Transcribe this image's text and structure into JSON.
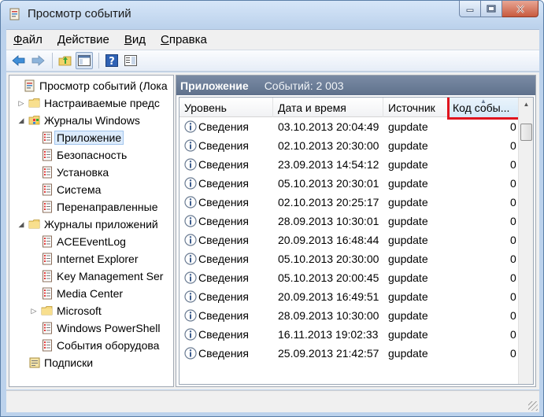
{
  "window": {
    "title": "Просмотр событий",
    "icon": "event-viewer-icon",
    "caption_buttons": [
      "minimize-icon",
      "maximize-icon",
      "close-icon"
    ]
  },
  "menu": {
    "items": [
      {
        "label": "Файл",
        "accel": "Ф",
        "rest": "айл"
      },
      {
        "label": "Действие",
        "accel": "Д",
        "rest": "ействие"
      },
      {
        "label": "Вид",
        "accel": "В",
        "rest": "ид"
      },
      {
        "label": "Справка",
        "accel": "С",
        "rest": "правка"
      }
    ]
  },
  "toolbar": {
    "buttons": [
      "back-arrow-icon",
      "forward-arrow-icon",
      "up-folder-icon",
      "show-hide-tree-icon",
      "help-icon",
      "show-action-pane-icon"
    ]
  },
  "tree": {
    "items": [
      {
        "label": "Просмотр событий (Лока",
        "level": 0,
        "expander": "",
        "icon": "event-viewer-icon"
      },
      {
        "label": "Настраиваемые предс",
        "level": 1,
        "expander": "▷",
        "icon": "folder-icon"
      },
      {
        "label": "Журналы Windows",
        "level": 1,
        "expander": "◢",
        "icon": "windows-logs-icon"
      },
      {
        "label": "Приложение",
        "level": 2,
        "expander": "",
        "icon": "log-icon",
        "selected": true
      },
      {
        "label": "Безопасность",
        "level": 2,
        "expander": "",
        "icon": "log-icon"
      },
      {
        "label": "Установка",
        "level": 2,
        "expander": "",
        "icon": "log-icon"
      },
      {
        "label": "Система",
        "level": 2,
        "expander": "",
        "icon": "log-icon"
      },
      {
        "label": "Перенаправленные",
        "level": 2,
        "expander": "",
        "icon": "log-icon"
      },
      {
        "label": "Журналы приложений",
        "level": 1,
        "expander": "◢",
        "icon": "folder-icon"
      },
      {
        "label": "ACEEventLog",
        "level": 2,
        "expander": "",
        "icon": "log-icon"
      },
      {
        "label": "Internet Explorer",
        "level": 2,
        "expander": "",
        "icon": "log-icon"
      },
      {
        "label": "Key Management Ser",
        "level": 2,
        "expander": "",
        "icon": "log-icon"
      },
      {
        "label": "Media Center",
        "level": 2,
        "expander": "",
        "icon": "log-icon"
      },
      {
        "label": "Microsoft",
        "level": 2,
        "expander": "▷",
        "icon": "folder-icon"
      },
      {
        "label": "Windows PowerShell",
        "level": 2,
        "expander": "",
        "icon": "log-icon"
      },
      {
        "label": "События оборудова",
        "level": 2,
        "expander": "",
        "icon": "log-icon"
      },
      {
        "label": "Подписки",
        "level": 1,
        "expander": "",
        "icon": "subscriptions-icon"
      }
    ]
  },
  "pane": {
    "title": "Приложение",
    "count": "Событий: 2 003"
  },
  "columns": [
    "Уровень",
    "Дата и время",
    "Источник",
    "Код собы..."
  ],
  "rows": [
    {
      "level": "Сведения",
      "datetime": "03.10.2013 20:04:49",
      "source": "gupdate",
      "code": "0"
    },
    {
      "level": "Сведения",
      "datetime": "02.10.2013 20:30:00",
      "source": "gupdate",
      "code": "0"
    },
    {
      "level": "Сведения",
      "datetime": "23.09.2013 14:54:12",
      "source": "gupdate",
      "code": "0"
    },
    {
      "level": "Сведения",
      "datetime": "05.10.2013 20:30:01",
      "source": "gupdate",
      "code": "0"
    },
    {
      "level": "Сведения",
      "datetime": "02.10.2013 20:25:17",
      "source": "gupdate",
      "code": "0"
    },
    {
      "level": "Сведения",
      "datetime": "28.09.2013 10:30:01",
      "source": "gupdate",
      "code": "0"
    },
    {
      "level": "Сведения",
      "datetime": "20.09.2013 16:48:44",
      "source": "gupdate",
      "code": "0"
    },
    {
      "level": "Сведения",
      "datetime": "05.10.2013 20:30:00",
      "source": "gupdate",
      "code": "0"
    },
    {
      "level": "Сведения",
      "datetime": "05.10.2013 20:00:45",
      "source": "gupdate",
      "code": "0"
    },
    {
      "level": "Сведения",
      "datetime": "20.09.2013 16:49:51",
      "source": "gupdate",
      "code": "0"
    },
    {
      "level": "Сведения",
      "datetime": "28.09.2013 10:30:00",
      "source": "gupdate",
      "code": "0"
    },
    {
      "level": "Сведения",
      "datetime": "16.11.2013 19:02:33",
      "source": "gupdate",
      "code": "0"
    },
    {
      "level": "Сведения",
      "datetime": "25.09.2013 21:42:57",
      "source": "gupdate",
      "code": "0"
    }
  ],
  "colors": {
    "titlebar": "#bcd2ec",
    "pane_header": "#6b7d98",
    "highlight": "#e0141e",
    "selection": "#dcebfc"
  }
}
